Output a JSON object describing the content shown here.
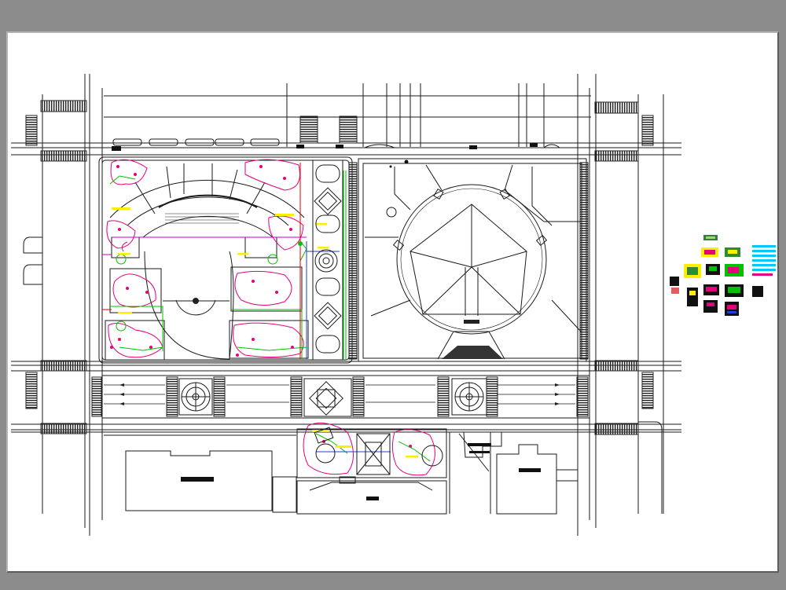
{
  "viewer": {
    "background_color": "#8c8c8c",
    "sheet_color": "#ffffff"
  },
  "drawing": {
    "line_color": "#1a1a1a",
    "layer_colors": {
      "walls": "#1a1a1a",
      "planting": "#e6007e",
      "paths": "#00c000",
      "markers": "#ffee00",
      "dimensions": "#1f3fd0",
      "hatch": "#444444"
    }
  }
}
